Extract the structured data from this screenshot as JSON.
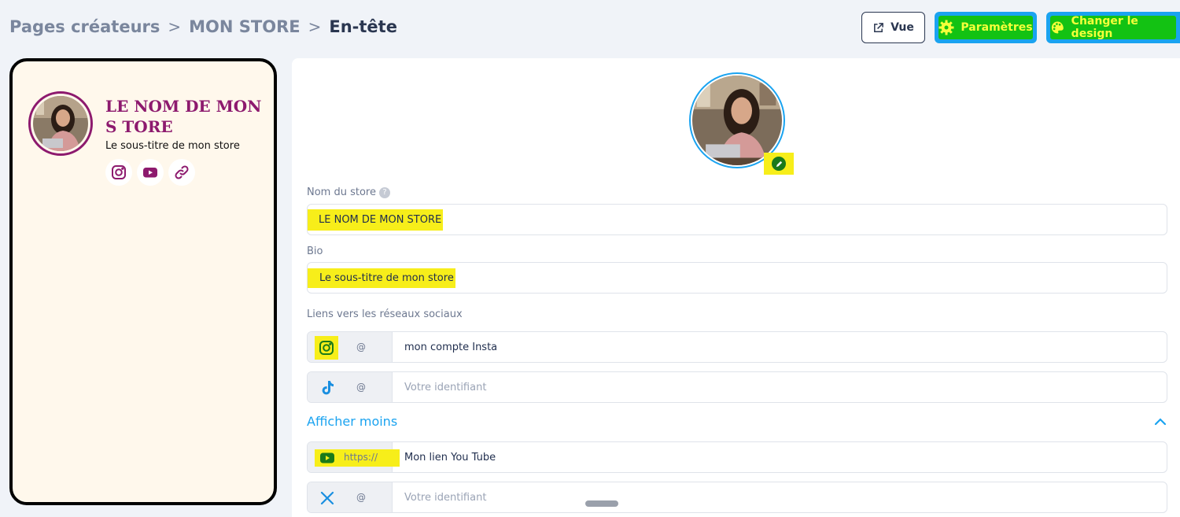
{
  "breadcrumb": {
    "items": [
      "Pages créateurs",
      "MON STORE",
      "En-tête"
    ],
    "separator": ">"
  },
  "actions": {
    "view_label": "Vue",
    "params_label": "Paramètres",
    "design_label": "Changer le design"
  },
  "preview": {
    "store_name": "LE NOM DE MON S TORE",
    "subtitle": "Le sous-titre de mon store",
    "socials": [
      "instagram-icon",
      "youtube-icon",
      "link-icon"
    ]
  },
  "form": {
    "store_name_label": "Nom du store",
    "store_name_help": "?",
    "store_name_value": "LE NOM DE MON STORE",
    "bio_label": "Bio",
    "bio_value": "Le sous-titre de mon store",
    "socials_label": "Liens vers les réseaux sociaux",
    "toggle_label": "Afficher moins",
    "social_rows": [
      {
        "icon": "instagram-icon",
        "prefix": "@",
        "value": "mon compte Insta",
        "placeholder": ""
      },
      {
        "icon": "tiktok-icon",
        "prefix": "@",
        "value": "",
        "placeholder": "Votre identifiant"
      },
      {
        "icon": "youtube-icon",
        "prefix": "https://",
        "value": "Mon lien You Tube",
        "placeholder": ""
      },
      {
        "icon": "x-twitter-icon",
        "prefix": "@",
        "value": "",
        "placeholder": "Votre identifiant"
      }
    ]
  },
  "colors": {
    "brand_blue": "#1aa3f0",
    "store_purple": "#8d1a6e",
    "highlight_yellow": "#f7ee1a",
    "highlight_green": "#13c213"
  }
}
